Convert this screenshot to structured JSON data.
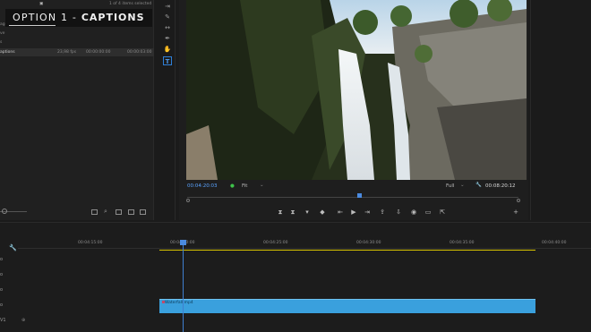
{
  "overlay": {
    "label_prefix": "OPTION 1 - ",
    "label_bold": "CAPTIONS"
  },
  "project": {
    "selection_info": "1 of 4 items selected",
    "row_name": "aptions",
    "row_fps": "23,98 fps",
    "row_in": "00:00:00:00",
    "row_out": "00:00:03:00",
    "sidebar_labels": [
      "age",
      "ve",
      "s"
    ],
    "partial_header": "edia End"
  },
  "program": {
    "timecode": "00:04:20:03",
    "fit_label": "Fit",
    "resolution_label": "Full",
    "duration": "00:08:20:12"
  },
  "timeline": {
    "ruler": [
      "00:04:15:00",
      "00:04:20:00",
      "00:04:25:00",
      "00:04:30:00",
      "00:04:35:00",
      "00:04:40:00"
    ],
    "clip_label": "Waterfall.mp4",
    "track_labels": [
      "o",
      "o",
      "o",
      "o",
      "V1"
    ]
  }
}
